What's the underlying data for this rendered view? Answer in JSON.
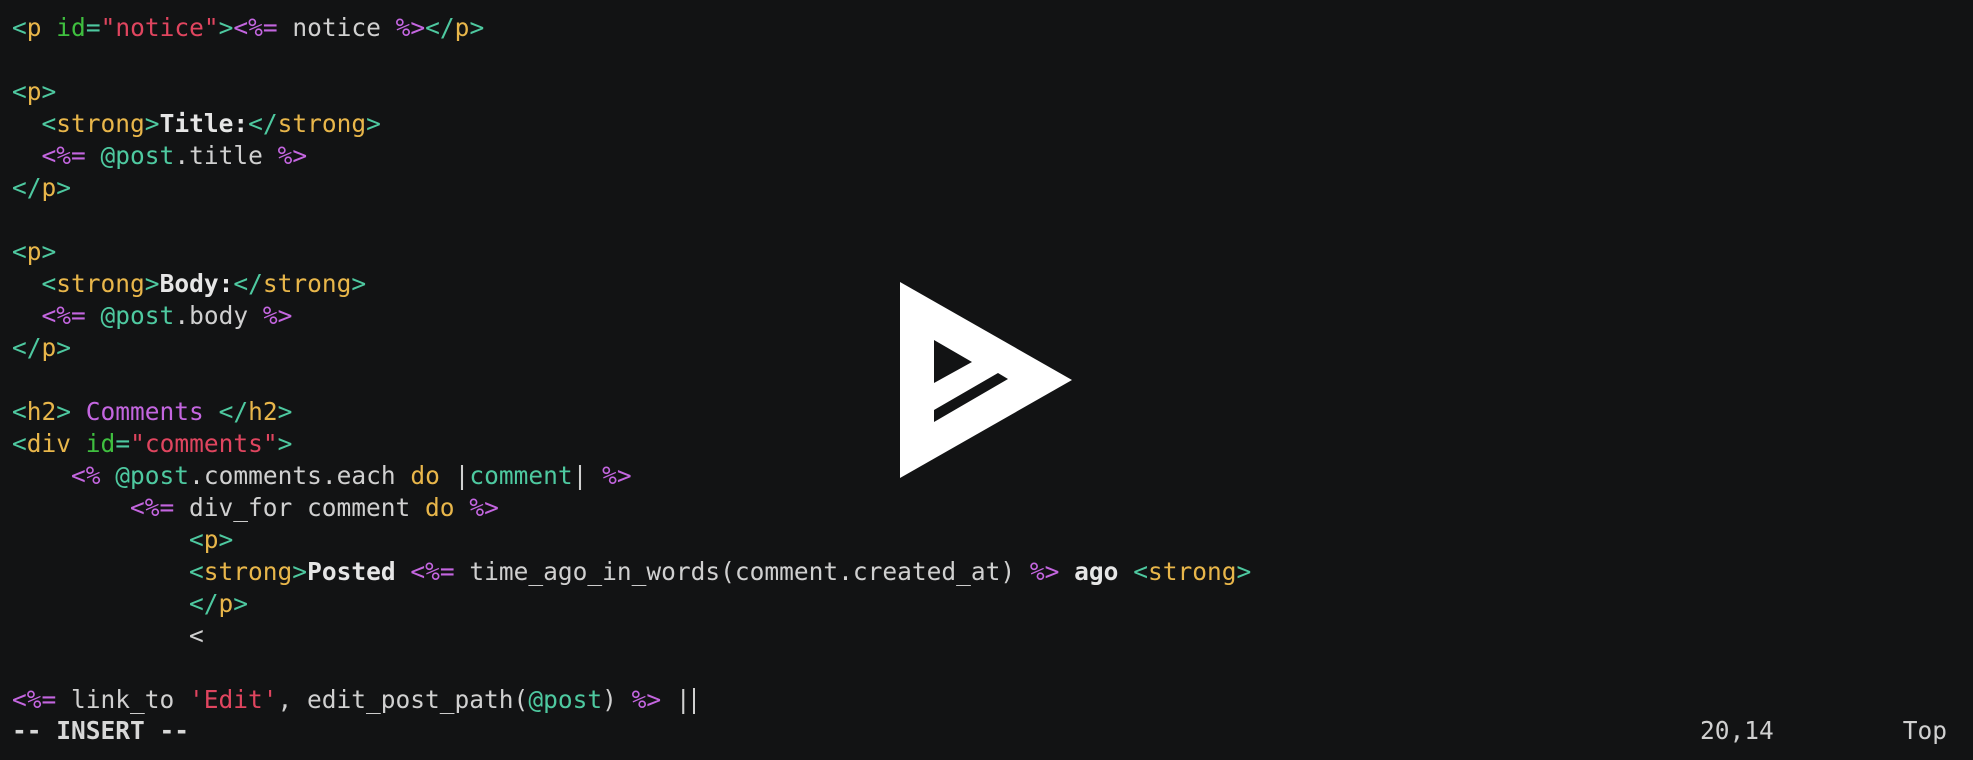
{
  "editor": {
    "lines": [
      [
        {
          "t": "<",
          "c": "tag"
        },
        {
          "t": "p",
          "c": "name"
        },
        {
          "t": " ",
          "c": "plain"
        },
        {
          "t": "id",
          "c": "attr"
        },
        {
          "t": "=",
          "c": "tag"
        },
        {
          "t": "\"notice\"",
          "c": "str"
        },
        {
          "t": ">",
          "c": "tag"
        },
        {
          "t": "<%=",
          "c": "erb"
        },
        {
          "t": " notice ",
          "c": "plain"
        },
        {
          "t": "%>",
          "c": "erb"
        },
        {
          "t": "</",
          "c": "tag"
        },
        {
          "t": "p",
          "c": "name"
        },
        {
          "t": ">",
          "c": "tag"
        }
      ],
      [],
      [
        {
          "t": "<",
          "c": "tag"
        },
        {
          "t": "p",
          "c": "name"
        },
        {
          "t": ">",
          "c": "tag"
        }
      ],
      [
        {
          "t": "  ",
          "c": "plain"
        },
        {
          "t": "<",
          "c": "tag"
        },
        {
          "t": "strong",
          "c": "name"
        },
        {
          "t": ">",
          "c": "tag"
        },
        {
          "t": "Title:",
          "c": "bold"
        },
        {
          "t": "</",
          "c": "tag"
        },
        {
          "t": "strong",
          "c": "name"
        },
        {
          "t": ">",
          "c": "tag"
        }
      ],
      [
        {
          "t": "  ",
          "c": "plain"
        },
        {
          "t": "<%=",
          "c": "erb"
        },
        {
          "t": " ",
          "c": "plain"
        },
        {
          "t": "@post",
          "c": "ivar"
        },
        {
          "t": ".title ",
          "c": "plain"
        },
        {
          "t": "%>",
          "c": "erb"
        }
      ],
      [
        {
          "t": "</",
          "c": "tag"
        },
        {
          "t": "p",
          "c": "name"
        },
        {
          "t": ">",
          "c": "tag"
        }
      ],
      [],
      [
        {
          "t": "<",
          "c": "tag"
        },
        {
          "t": "p",
          "c": "name"
        },
        {
          "t": ">",
          "c": "tag"
        }
      ],
      [
        {
          "t": "  ",
          "c": "plain"
        },
        {
          "t": "<",
          "c": "tag"
        },
        {
          "t": "strong",
          "c": "name"
        },
        {
          "t": ">",
          "c": "tag"
        },
        {
          "t": "Body:",
          "c": "bold"
        },
        {
          "t": "</",
          "c": "tag"
        },
        {
          "t": "strong",
          "c": "name"
        },
        {
          "t": ">",
          "c": "tag"
        }
      ],
      [
        {
          "t": "  ",
          "c": "plain"
        },
        {
          "t": "<%=",
          "c": "erb"
        },
        {
          "t": " ",
          "c": "plain"
        },
        {
          "t": "@post",
          "c": "ivar"
        },
        {
          "t": ".body ",
          "c": "plain"
        },
        {
          "t": "%>",
          "c": "erb"
        }
      ],
      [
        {
          "t": "</",
          "c": "tag"
        },
        {
          "t": "p",
          "c": "name"
        },
        {
          "t": ">",
          "c": "tag"
        }
      ],
      [],
      [
        {
          "t": "<",
          "c": "tag"
        },
        {
          "t": "h2",
          "c": "name"
        },
        {
          "t": ">",
          "c": "tag"
        },
        {
          "t": " Comments ",
          "c": "erbtext"
        },
        {
          "t": "</",
          "c": "tag"
        },
        {
          "t": "h2",
          "c": "name"
        },
        {
          "t": ">",
          "c": "tag"
        }
      ],
      [
        {
          "t": "<",
          "c": "tag"
        },
        {
          "t": "div",
          "c": "name"
        },
        {
          "t": " ",
          "c": "plain"
        },
        {
          "t": "id",
          "c": "attr"
        },
        {
          "t": "=",
          "c": "tag"
        },
        {
          "t": "\"comments\"",
          "c": "str"
        },
        {
          "t": ">",
          "c": "tag"
        }
      ],
      [
        {
          "t": "    ",
          "c": "plain"
        },
        {
          "t": "<%",
          "c": "erb"
        },
        {
          "t": " ",
          "c": "plain"
        },
        {
          "t": "@post",
          "c": "ivar"
        },
        {
          "t": ".comments.each ",
          "c": "plain"
        },
        {
          "t": "do",
          "c": "kw"
        },
        {
          "t": " |",
          "c": "plain"
        },
        {
          "t": "comment",
          "c": "ivar"
        },
        {
          "t": "| ",
          "c": "plain"
        },
        {
          "t": "%>",
          "c": "erb"
        }
      ],
      [
        {
          "t": "        ",
          "c": "plain"
        },
        {
          "t": "<%=",
          "c": "erb"
        },
        {
          "t": " div_for comment ",
          "c": "plain"
        },
        {
          "t": "do",
          "c": "kw"
        },
        {
          "t": " ",
          "c": "plain"
        },
        {
          "t": "%>",
          "c": "erb"
        }
      ],
      [
        {
          "t": "            ",
          "c": "plain"
        },
        {
          "t": "<",
          "c": "tag"
        },
        {
          "t": "p",
          "c": "name"
        },
        {
          "t": ">",
          "c": "tag"
        }
      ],
      [
        {
          "t": "            ",
          "c": "plain"
        },
        {
          "t": "<",
          "c": "tag"
        },
        {
          "t": "strong",
          "c": "name"
        },
        {
          "t": ">",
          "c": "tag"
        },
        {
          "t": "Posted",
          "c": "bold"
        },
        {
          "t": " ",
          "c": "plain"
        },
        {
          "t": "<%=",
          "c": "erb"
        },
        {
          "t": " time_ago_in_words(comment.created_at) ",
          "c": "plain"
        },
        {
          "t": "%>",
          "c": "erb"
        },
        {
          "t": " ",
          "c": "plain"
        },
        {
          "t": "ago",
          "c": "bold"
        },
        {
          "t": " ",
          "c": "plain"
        },
        {
          "t": "<",
          "c": "tag"
        },
        {
          "t": "strong",
          "c": "name"
        },
        {
          "t": ">",
          "c": "tag"
        }
      ],
      [
        {
          "t": "            ",
          "c": "plain"
        },
        {
          "t": "</",
          "c": "tag"
        },
        {
          "t": "p",
          "c": "name"
        },
        {
          "t": ">",
          "c": "tag"
        }
      ],
      [
        {
          "t": "            ",
          "c": "plain"
        },
        {
          "t": "<",
          "c": "plain"
        }
      ],
      [],
      [
        {
          "t": "<%=",
          "c": "erb"
        },
        {
          "t": " link_to ",
          "c": "plain"
        },
        {
          "t": "'Edit'",
          "c": "str"
        },
        {
          "t": ", edit_post_path(",
          "c": "plain"
        },
        {
          "t": "@post",
          "c": "ivar"
        },
        {
          "t": ") ",
          "c": "plain"
        },
        {
          "t": "%>",
          "c": "erb"
        },
        {
          "t": " |",
          "c": "plain"
        }
      ]
    ]
  },
  "statusline": {
    "mode": "-- INSERT --",
    "ruler": "20,14",
    "scroll": "Top"
  },
  "overlay": {
    "icon": "play-icon",
    "colors": {
      "fill": "#ffffff",
      "cutout": "#121314"
    }
  },
  "colors": {
    "background": "#121314",
    "tag": "#4ec9a0",
    "tag_name": "#e8b64a",
    "attribute": "#3fbf3f",
    "string": "#e0455f",
    "erb": "#c466e0",
    "text": "#d0d0d0"
  }
}
